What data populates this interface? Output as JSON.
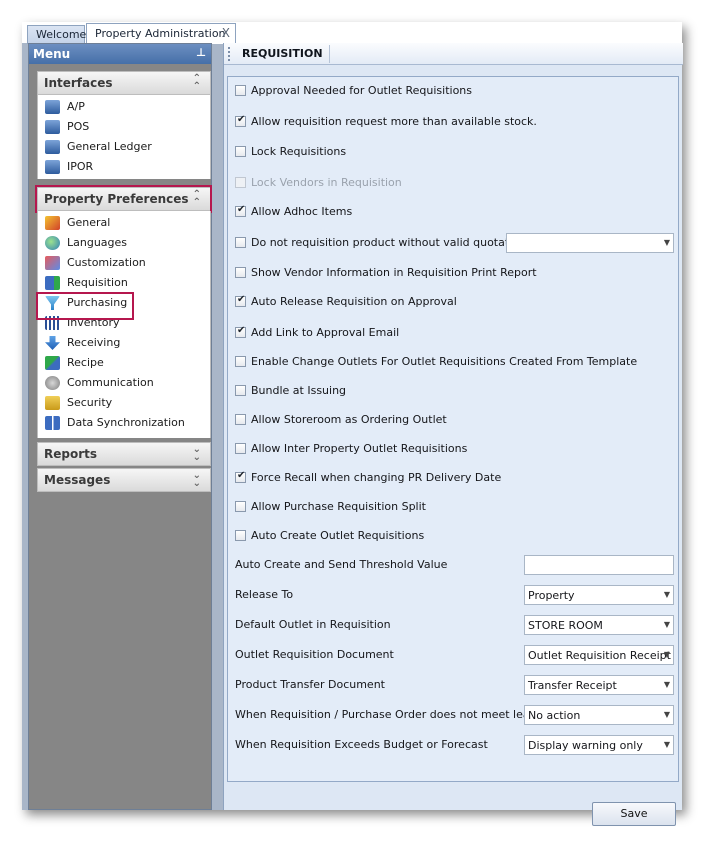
{
  "tabs": [
    {
      "label": "Welcome"
    },
    {
      "label": "Property Administration",
      "close": "X"
    }
  ],
  "menu": {
    "title": "Menu",
    "groups": {
      "interfaces": {
        "title": "Interfaces",
        "items": [
          "A/P",
          "POS",
          "General Ledger",
          "IPOR"
        ]
      },
      "property_preferences": {
        "title": "Property Preferences",
        "items": [
          "General",
          "Languages",
          "Customization",
          "Requisition",
          "Purchasing",
          "Inventory",
          "Receiving",
          "Recipe",
          "Communication",
          "Security",
          "Data Synchronization"
        ]
      },
      "reports": {
        "title": "Reports"
      },
      "messages": {
        "title": "Messages"
      }
    }
  },
  "panel": {
    "title": "REQUISITION",
    "checkboxes": [
      {
        "label": "Approval Needed for Outlet Requisitions",
        "checked": false
      },
      {
        "label": "Allow requisition request more than available stock.",
        "checked": true
      },
      {
        "label": "Lock Requisitions",
        "checked": false
      },
      {
        "label": "Lock Vendors in Requisition",
        "checked": false,
        "disabled": true
      },
      {
        "label": "Allow Adhoc Items",
        "checked": true
      },
      {
        "label": "Do not requisition  product without valid quotation",
        "checked": false
      },
      {
        "label": "Show Vendor Information in Requisition Print Report",
        "checked": false
      },
      {
        "label": "Auto Release Requisition on Approval",
        "checked": true
      },
      {
        "label": "Add Link to Approval Email",
        "checked": true
      },
      {
        "label": "Enable Change Outlets For Outlet Requisitions Created From Template",
        "checked": false
      },
      {
        "label": "Bundle at Issuing",
        "checked": false
      },
      {
        "label": "Allow Storeroom as Ordering Outlet",
        "checked": false
      },
      {
        "label": "Allow Inter Property Outlet Requisitions",
        "checked": false
      },
      {
        "label": "Force Recall when changing PR Delivery Date",
        "checked": true
      },
      {
        "label": "Allow Purchase Requisition Split",
        "checked": false
      },
      {
        "label": "Auto Create Outlet Requisitions",
        "checked": false
      }
    ],
    "quotation_combo": "",
    "threshold": {
      "label": "Auto Create and Send Threshold Value",
      "value": ""
    },
    "fields": [
      {
        "label": "Release To",
        "value": "Property"
      },
      {
        "label": "Default Outlet in Requisition",
        "value": "STORE ROOM"
      },
      {
        "label": "Outlet Requisition Document",
        "value": "Outlet Requisition Receipt"
      },
      {
        "label": "Product Transfer Document",
        "value": "Transfer Receipt"
      },
      {
        "label": "When Requisition / Purchase Order does not meet lead time",
        "value": "No action"
      },
      {
        "label": "When Requisition Exceeds Budget or Forecast",
        "value": "Display warning only"
      }
    ],
    "save_label": "Save"
  },
  "colors": {
    "highlight": "#b5174e",
    "menu_header": "#456fa8"
  }
}
